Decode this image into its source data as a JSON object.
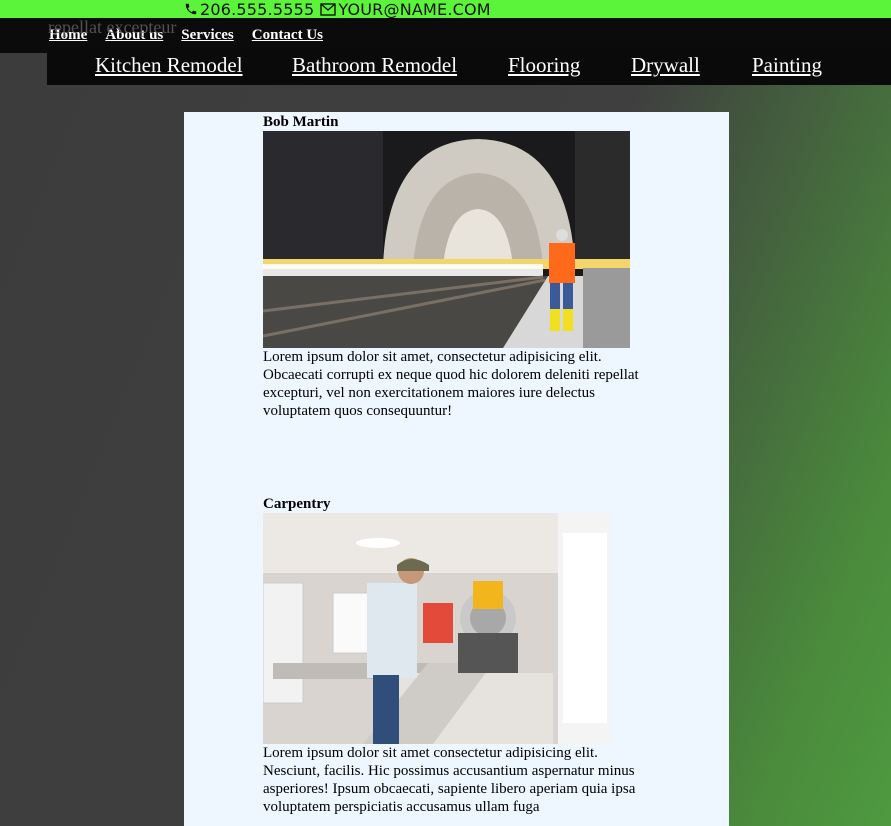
{
  "contact": {
    "phone": "206.555.5555",
    "email": "YOUR@NAME.COM",
    "phone_icon": "phone-icon",
    "email_icon": "envelope-icon"
  },
  "ghost_text": "repellat excepteur",
  "nav": [
    "Home",
    "About us",
    "Services",
    "Contact Us"
  ],
  "services": [
    "Kitchen Remodel",
    "Bathroom Remodel",
    "Flooring",
    "Drywall",
    "Painting"
  ],
  "sections": [
    {
      "title": "Bob Martin",
      "image": "tunnel-worker-photo",
      "text": "Lorem ipsum dolor sit amet, consectetur adipisicing elit. Obcaecati corrupti ex neque quod hic dolorem deleniti repellat excepturi, vel non exercitationem maiores iure delectus voluptatem quos consequuntur!"
    },
    {
      "title": "Carpentry",
      "image": "carpentry-saw-photo",
      "text": "Lorem ipsum dolor sit amet consectetur adipisicing elit. Nesciunt, facilis. Hic possimus accusantium aspernatur minus asperiores! Ipsum obcaecati, sapiente libero aperiam quia ipsa voluptatem perspiciatis accusamus ullam fuga"
    }
  ],
  "colors": {
    "accent": "#5cf43a",
    "navbar": "#0b0b0b",
    "content_bg": "#eef6ff"
  }
}
